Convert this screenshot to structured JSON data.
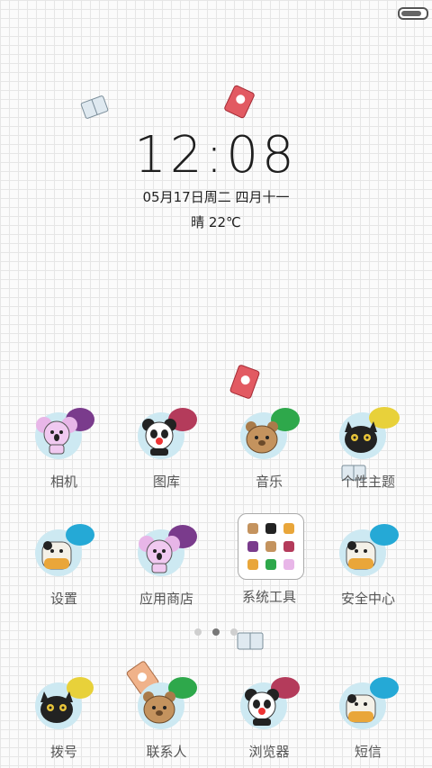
{
  "status_bar": {
    "battery_level": 0.85
  },
  "clock": {
    "time": "12:08"
  },
  "date": {
    "text": "05月17日周二 四月十一"
  },
  "weather": {
    "text": "晴 22℃"
  },
  "apps_row1": [
    {
      "label": "相机",
      "icon": "koala-icon"
    },
    {
      "label": "图库",
      "icon": "panda-icon"
    },
    {
      "label": "音乐",
      "icon": "bear-icon"
    },
    {
      "label": "个性主题",
      "icon": "cat-icon"
    }
  ],
  "apps_row2": [
    {
      "label": "设置",
      "icon": "cow-icon"
    },
    {
      "label": "应用商店",
      "icon": "koala-icon"
    },
    {
      "label": "系统工具",
      "icon": "folder-icon"
    },
    {
      "label": "安全中心",
      "icon": "cow-icon"
    }
  ],
  "dock": [
    {
      "label": "拨号",
      "icon": "cat-icon"
    },
    {
      "label": "联系人",
      "icon": "bear-icon"
    },
    {
      "label": "浏览器",
      "icon": "panda-icon"
    },
    {
      "label": "短信",
      "icon": "cow-icon"
    }
  ],
  "page_indicator": {
    "count": 3,
    "active": 1
  },
  "colors": {
    "bubble_blue": "#cde9f2",
    "bubble_purple": "#7a3b8c",
    "bubble_green": "#2ea84b",
    "bubble_yellow": "#e8d13a",
    "bubble_cyan": "#25a9d6",
    "bubble_red": "#b43b5b"
  }
}
